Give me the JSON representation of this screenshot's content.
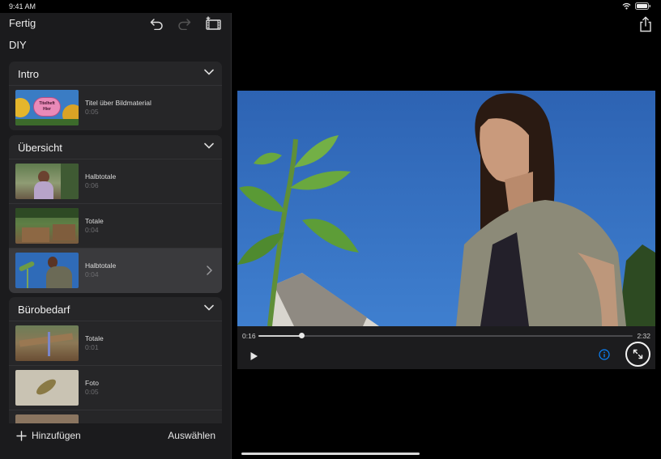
{
  "status": {
    "time": "9:41 AM"
  },
  "toolbar": {
    "done_label": "Fertig"
  },
  "project": {
    "title": "DIY"
  },
  "sections": [
    {
      "title": "Intro",
      "clips": [
        {
          "title": "Titel über Bildmaterial",
          "duration": "0:05",
          "thumb_text": "Titelheft Hier"
        }
      ]
    },
    {
      "title": "Übersicht",
      "clips": [
        {
          "title": "Halbtotale",
          "duration": "0:06"
        },
        {
          "title": "Totale",
          "duration": "0:04"
        },
        {
          "title": "Halbtotale",
          "duration": "0:04"
        }
      ]
    },
    {
      "title": "Bürobedarf",
      "clips": [
        {
          "title": "Totale",
          "duration": "0:01"
        },
        {
          "title": "Foto",
          "duration": "0:05"
        }
      ]
    }
  ],
  "bottom": {
    "add_label": "Hinzufügen",
    "select_label": "Auswählen"
  },
  "player": {
    "current_time": "0:16",
    "total_time": "2:32",
    "progress": 0.114
  },
  "colors": {
    "accent": "#0a84ff",
    "sidebar_bg": "#1b1b1d",
    "card_bg": "#262628",
    "selected_bg": "#3a3a3d"
  }
}
